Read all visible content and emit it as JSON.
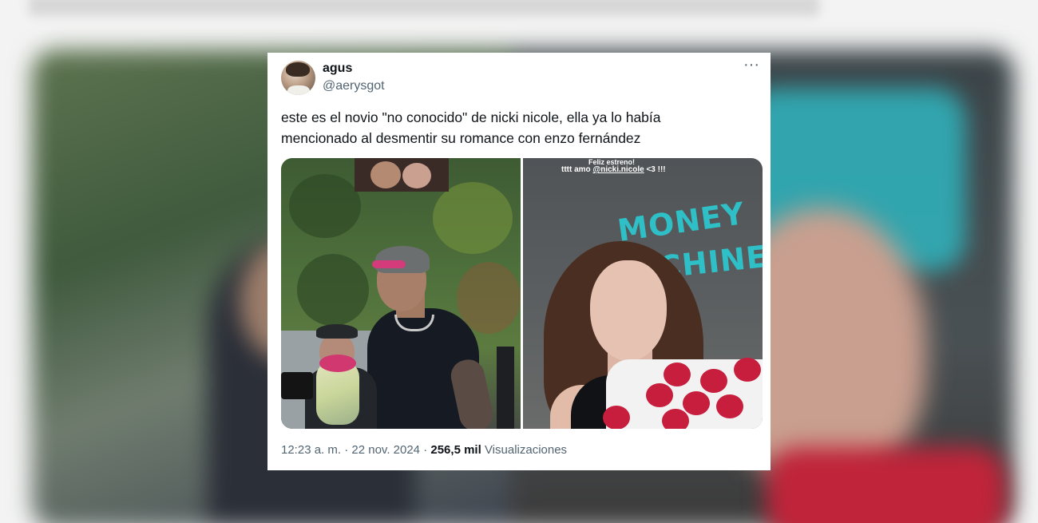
{
  "tweet": {
    "author_name": "agus",
    "author_handle": "@aerysgot",
    "more_label": "···",
    "text_line1": "este es el novio \"no conocido\" de nicki nicole, ella ya lo había",
    "text_line2": "mencionado al desmentir su romance con enzo fernández",
    "media": {
      "right_story_line1": "Feliz estreno!",
      "right_story_line2_prefix": "tttt amo ",
      "right_story_mention": "@nicki.nicole",
      "right_story_line2_suffix": " <3 !!!",
      "graffiti_line1": "MONEY",
      "graffiti_line2": "CHINE"
    },
    "time": "12:23 a. m.",
    "separator": "·",
    "date": "22 nov. 2024",
    "views_count": "256,5 mil",
    "views_label": "Visualizaciones"
  },
  "colors": {
    "primary_text": "#0f1419",
    "secondary_text": "#536471",
    "card_bg": "#ffffff"
  },
  "icons": {
    "more": "more-horizontal-icon"
  }
}
